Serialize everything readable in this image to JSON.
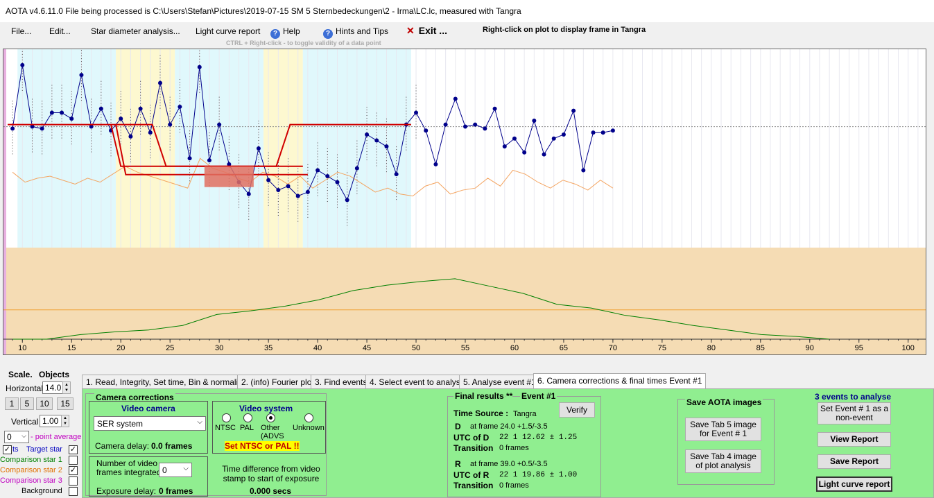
{
  "window": {
    "title": "AOTA v4.6.11.0    File being processed is C:\\Users\\Stefan\\Pictures\\2019-07-15 SM 5 Sternbedeckungen\\2 - Irma\\LC.lc, measured with Tangra"
  },
  "menu": {
    "file": "File...",
    "edit": "Edit...",
    "star_diameter": "Star diameter analysis...",
    "light_curve_report": "Light curve report",
    "help": "Help",
    "hints": "Hints and Tips",
    "exit": "Exit ...",
    "hint_right_click": "Right-click on plot to display frame in Tangra",
    "hint_ctrl": "CTRL + Right-click  -  to toggle validity of a data point"
  },
  "plot": {
    "x_ticks": [
      "10",
      "15",
      "20",
      "25",
      "30",
      "35",
      "40",
      "45",
      "50",
      "55",
      "60",
      "65",
      "70",
      "75",
      "80",
      "85",
      "90",
      "95",
      "100"
    ],
    "target_points": [
      0.6,
      0.92,
      0.61,
      0.6,
      0.68,
      0.68,
      0.65,
      0.87,
      0.61,
      0.7,
      0.59,
      0.65,
      0.56,
      0.7,
      0.58,
      0.83,
      0.62,
      0.71,
      0.45,
      0.91,
      0.44,
      0.62,
      0.42,
      0.33,
      0.27,
      0.5,
      0.34,
      0.29,
      0.31,
      0.26,
      0.28,
      0.39,
      0.36,
      0.33,
      0.24,
      0.4,
      0.57,
      0.54,
      0.51,
      0.37,
      0.62,
      0.68,
      0.59,
      0.42,
      0.62,
      0.75,
      0.61,
      0.62,
      0.6,
      0.7,
      0.51,
      0.55,
      0.48,
      0.64,
      0.47,
      0.55,
      0.57,
      0.69,
      0.39,
      0.58,
      0.58,
      0.59
    ],
    "comparison1_points": [
      0.38,
      0.33,
      0.35,
      0.36,
      0.34,
      0.32,
      0.35,
      0.33,
      0.37,
      0.41,
      0.38,
      0.36,
      0.34,
      0.32,
      0.3,
      0.45,
      0.4,
      0.38,
      0.35,
      0.33,
      0.38,
      0.36,
      0.32,
      0.36,
      0.3,
      0.34,
      0.38,
      0.36,
      0.32,
      0.28,
      0.3,
      0.27,
      0.26,
      0.31,
      0.33,
      0.27,
      0.29,
      0.3,
      0.35,
      0.31,
      0.39,
      0.37,
      0.33,
      0.3,
      0.34,
      0.32,
      0.29,
      0.34,
      0.3
    ],
    "comparison2_points": [
      0.0,
      0.0,
      0.05,
      0.08,
      0.1,
      0.15,
      0.27,
      0.31,
      0.36,
      0.43,
      0.53,
      0.59,
      0.63,
      0.66,
      0.58,
      0.5,
      0.38,
      0.34,
      0.26,
      0.21,
      0.15,
      0.1,
      0.05,
      0.03,
      0.0
    ],
    "normal_level": 0.62,
    "event_level": 0.41,
    "event1_d_frame": 24.0,
    "event1_r_frame": 39.0,
    "x_min": 8.5,
    "x_max": 101.5
  },
  "left": {
    "scale_label": "Scale.",
    "objects_label": "Objects",
    "horizontal_label": "Horizontal",
    "horizontal_value": "14.0",
    "scale_buttons": [
      "1",
      "5",
      "10",
      "15"
    ],
    "vertical_label": "Vertical",
    "vertical_value": "1.00",
    "point_average_value": "0",
    "point_average_label": "- point average",
    "pts_label": "ts",
    "target_label": "Target star",
    "comp1_label": "Comparison star 1",
    "comp2_label": "Comparison star 2",
    "comp3_label": "Comparison star 3",
    "background_label": "Background"
  },
  "tabs": [
    "1.  Read, Integrity, Set time, Bin & normalise",
    "2. (info)  Fourier plot",
    "3. Find events",
    "4. Select event to analyse",
    "5. Analyse event #1",
    "6. Camera corrections & final times Event #1"
  ],
  "camera": {
    "section_title": "Camera corrections",
    "video_camera_title": "Video camera",
    "camera_select": "SER system",
    "camera_delay_label": "Camera delay:",
    "camera_delay_value": "0.0 frames",
    "video_system_title": "Video system",
    "vs_ntsc": "NTSC",
    "vs_pal": "PAL",
    "vs_other": "Other (ADVS",
    "vs_unknown": "Unknown",
    "vs_warning": "Set NTSC or PAL !!",
    "frames_integrated_label": "Number of video frames integrated",
    "frames_integrated_value": "0",
    "exposure_delay_label": "Exposure delay:",
    "exposure_delay_value": "0 frames",
    "time_diff_label": "Time difference from video stamp to start of exposure",
    "time_diff_value": "0.000 secs"
  },
  "final": {
    "title": "Final results",
    "stars": "**",
    "event": "Event #1",
    "verify": "Verify",
    "time_source_label": "Time Source :",
    "time_source_value": "Tangra",
    "d_label": "D",
    "d_frame": "at frame 24.0  +1.5/-3.5",
    "utc_d_label": "UTC of D",
    "utc_d_value": "22  1 12.62  ± 1.25",
    "transition_label": "Transition",
    "d_transition": "0 frames",
    "r_label": "R",
    "r_frame": "at frame 39.0  +0.5/-3.5",
    "utc_r_label": "UTC of R",
    "utc_r_value": "22  1 19.86  ± 1.00",
    "r_transition": "0 frames"
  },
  "save": {
    "title": "Save AOTA images",
    "tab5": "Save Tab 5 image for Event # 1",
    "tab4": "Save Tab 4 image of plot analysis"
  },
  "events": {
    "title": "3  events to analyse",
    "set_non_event": "Set Event # 1 as a non-event",
    "view_report": "View Report",
    "save_report": "Save Report",
    "light_curve_report": "Light curve report"
  },
  "colors": {
    "target": "#00008b",
    "comparison1": "#f4a460",
    "comparison2": "#008000",
    "model": "#d00000",
    "panel_green": "#90ee90",
    "plot_band_cyan": "#e0f8fc",
    "plot_band_yellow": "#fdf8d0",
    "plot_lower_tan": "#f5dcb4"
  }
}
